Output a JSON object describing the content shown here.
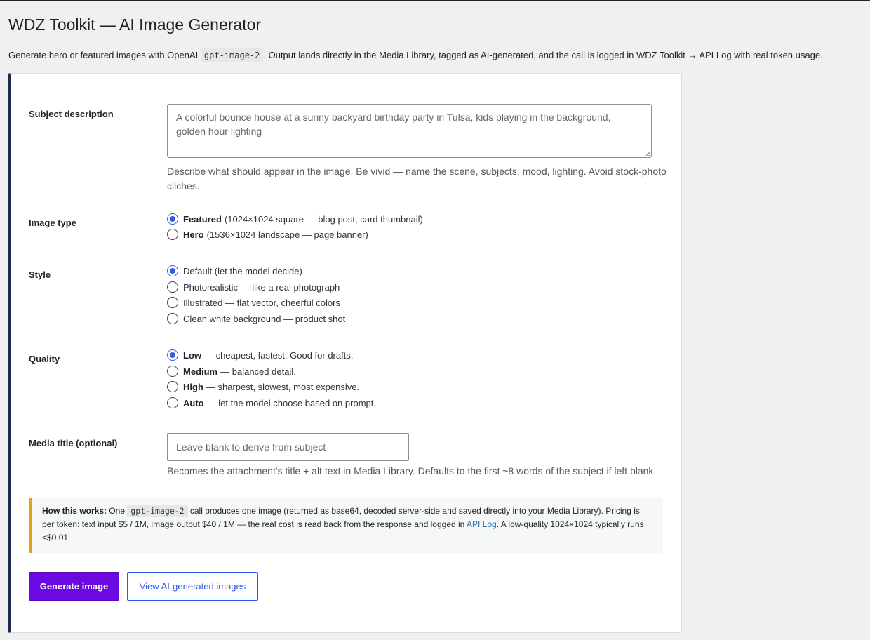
{
  "page": {
    "title": "WDZ Toolkit — AI Image Generator",
    "intro_before": "Generate hero or featured images with OpenAI ",
    "intro_code": "gpt-image-2",
    "intro_after": ". Output lands directly in the Media Library, tagged as AI-generated, and the call is logged in WDZ Toolkit → API Log with real token usage."
  },
  "subject": {
    "label": "Subject description",
    "value": "A colorful bounce house at a sunny backyard birthday party in Tulsa, kids playing in the background, golden hour lighting",
    "help": "Describe what should appear in the image. Be vivid — name the scene, subjects, mood, lighting. Avoid stock-photo cliches."
  },
  "image_type": {
    "label": "Image type",
    "options": [
      {
        "name": "Featured",
        "detail": "(1024×1024 square — blog post, card thumbnail)",
        "checked": true
      },
      {
        "name": "Hero",
        "detail": "(1536×1024 landscape — page banner)",
        "checked": false
      }
    ]
  },
  "style": {
    "label": "Style",
    "options": [
      {
        "text": "Default (let the model decide)",
        "checked": true
      },
      {
        "text": "Photorealistic — like a real photograph",
        "checked": false
      },
      {
        "text": "Illustrated — flat vector, cheerful colors",
        "checked": false
      },
      {
        "text": "Clean white background — product shot",
        "checked": false
      }
    ]
  },
  "quality": {
    "label": "Quality",
    "options": [
      {
        "name": "Low",
        "detail": "— cheapest, fastest. Good for drafts.",
        "checked": true
      },
      {
        "name": "Medium",
        "detail": "— balanced detail.",
        "checked": false
      },
      {
        "name": "High",
        "detail": "— sharpest, slowest, most expensive.",
        "checked": false
      },
      {
        "name": "Auto",
        "detail": "— let the model choose based on prompt.",
        "checked": false
      }
    ]
  },
  "media_title": {
    "label": "Media title (optional)",
    "placeholder": "Leave blank to derive from subject",
    "help": "Becomes the attachment's title + alt text in Media Library. Defaults to the first ~8 words of the subject if left blank."
  },
  "notice": {
    "heading": "How this works:",
    "text_1": " One ",
    "code": "gpt-image-2",
    "text_2": " call produces one image (returned as base64, decoded server-side and saved directly into your Media Library). Pricing is per token: text input $5 / 1M, image output $40 / 1M — the real cost is read back from the response and logged in ",
    "link": "API Log",
    "text_3": ". A low-quality 1024×1024 typically runs <$0.01."
  },
  "buttons": {
    "generate": "Generate image",
    "view": "View AI-generated images"
  },
  "colors": {
    "primary": "#6b0ae0",
    "accent": "#2f5bea",
    "card_border": "#1d2c4c",
    "notice_border": "#dba617"
  }
}
